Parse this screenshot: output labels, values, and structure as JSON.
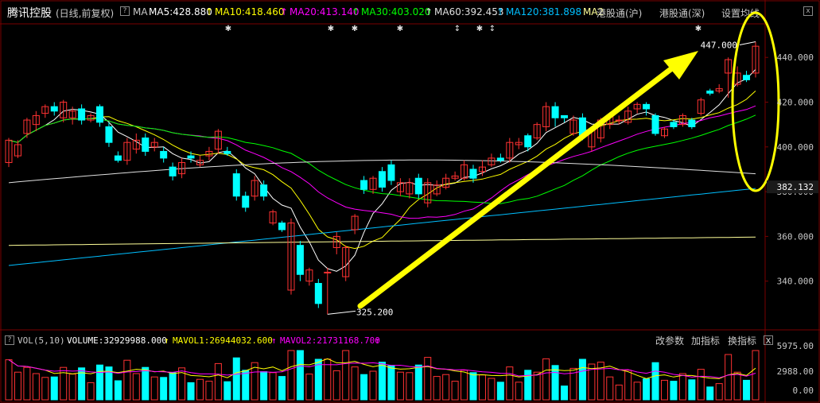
{
  "header": {
    "stock_name": "腾讯控股",
    "period": "(日线,前复权)",
    "ma_label": "MA",
    "ma5": "MA5:428.880",
    "ma10": "MA10:418.460",
    "ma20": "MA20:413.140",
    "ma30": "MA30:403.020",
    "ma60": "MA60:392.453",
    "ma120": "MA120:381.898",
    "ma_cut": "MA2",
    "hk_sh": "港股通(沪)",
    "hk_sz": "港股通(深)",
    "settings": "设置均线",
    "box_question": "?",
    "box_close": "x"
  },
  "price_axis": [
    "440.000",
    "420.000",
    "400.000",
    "380.000",
    "360.000",
    "340.000"
  ],
  "current_price": "382.132",
  "annotations": {
    "high": "447.000",
    "low": "325.200"
  },
  "volume": {
    "label": "VOL(5,10)",
    "volume_value": "VOLUME:32929988.000",
    "mavol1": "MAVOL1:26944032.600",
    "mavol2": "MAVOL2:21731168.700",
    "axis": [
      "5975.00",
      "2988.00",
      "0.00"
    ],
    "buttons": [
      "改参数",
      "加指标",
      "换指标"
    ],
    "close": "x"
  },
  "colors": {
    "up": "#ff3232",
    "down": "#00ffff",
    "ma5": "#ffffff",
    "ma10": "#ffff00",
    "ma20": "#ff00ff",
    "ma30": "#00ff00",
    "ma60": "#e0e0e0",
    "ma120": "#00bfff",
    "ma250": "#ffff99",
    "highlight": "#ffff00"
  },
  "chart_data": {
    "type": "candlestick",
    "candles": [
      {
        "o": 393,
        "c": 403,
        "h": 404,
        "l": 391
      },
      {
        "o": 396,
        "c": 401,
        "h": 403,
        "l": 395
      },
      {
        "o": 406,
        "c": 412,
        "h": 413,
        "l": 404
      },
      {
        "o": 410,
        "c": 414,
        "h": 416,
        "l": 407
      },
      {
        "o": 415,
        "c": 418,
        "h": 419,
        "l": 413
      },
      {
        "o": 418,
        "c": 416,
        "h": 420,
        "l": 414
      },
      {
        "o": 413,
        "c": 420,
        "h": 421,
        "l": 411
      },
      {
        "o": 413,
        "c": 416,
        "h": 418,
        "l": 410
      },
      {
        "o": 417,
        "c": 412,
        "h": 419,
        "l": 410
      },
      {
        "o": 412,
        "c": 414,
        "h": 415,
        "l": 411
      },
      {
        "o": 418,
        "c": 411,
        "h": 419,
        "l": 409
      },
      {
        "o": 409,
        "c": 402,
        "h": 411,
        "l": 400
      },
      {
        "o": 396,
        "c": 394,
        "h": 398,
        "l": 393
      },
      {
        "o": 394,
        "c": 402,
        "h": 404,
        "l": 392
      },
      {
        "o": 399,
        "c": 403,
        "h": 406,
        "l": 397
      },
      {
        "o": 404,
        "c": 398,
        "h": 406,
        "l": 396
      },
      {
        "o": 400,
        "c": 402,
        "h": 404,
        "l": 398
      },
      {
        "o": 398,
        "c": 395,
        "h": 400,
        "l": 393
      },
      {
        "o": 391,
        "c": 387,
        "h": 393,
        "l": 385
      },
      {
        "o": 388,
        "c": 393,
        "h": 395,
        "l": 386
      },
      {
        "o": 396,
        "c": 395,
        "h": 398,
        "l": 393
      },
      {
        "o": 392,
        "c": 394,
        "h": 396,
        "l": 391
      },
      {
        "o": 396,
        "c": 398,
        "h": 400,
        "l": 394
      },
      {
        "o": 399,
        "c": 407,
        "h": 408,
        "l": 397
      },
      {
        "o": 398,
        "c": 397,
        "h": 400,
        "l": 396
      },
      {
        "o": 388,
        "c": 378,
        "h": 390,
        "l": 376
      },
      {
        "o": 378,
        "c": 373,
        "h": 380,
        "l": 371
      },
      {
        "o": 378,
        "c": 385,
        "h": 387,
        "l": 376
      },
      {
        "o": 383,
        "c": 378,
        "h": 385,
        "l": 376
      },
      {
        "o": 366,
        "c": 371,
        "h": 372,
        "l": 365
      },
      {
        "o": 366,
        "c": 363,
        "h": 367,
        "l": 362
      },
      {
        "o": 336,
        "c": 366,
        "h": 368,
        "l": 334
      },
      {
        "o": 356,
        "c": 343,
        "h": 358,
        "l": 340
      },
      {
        "o": 340,
        "c": 345,
        "h": 346,
        "l": 338
      },
      {
        "o": 339,
        "c": 330,
        "h": 341,
        "l": 328
      },
      {
        "o": 344,
        "c": 344,
        "h": 346,
        "l": 325.2
      },
      {
        "o": 355,
        "c": 360,
        "h": 362,
        "l": 352
      },
      {
        "o": 342,
        "c": 355,
        "h": 356,
        "l": 340
      },
      {
        "o": 363,
        "c": 369,
        "h": 370,
        "l": 361
      },
      {
        "o": 385,
        "c": 381,
        "h": 387,
        "l": 379
      },
      {
        "o": 381,
        "c": 386,
        "h": 387,
        "l": 379
      },
      {
        "o": 389,
        "c": 382,
        "h": 391,
        "l": 380
      },
      {
        "o": 392,
        "c": 385,
        "h": 394,
        "l": 383
      },
      {
        "o": 380,
        "c": 384,
        "h": 386,
        "l": 378
      },
      {
        "o": 379,
        "c": 384,
        "h": 386,
        "l": 377
      },
      {
        "o": 386,
        "c": 379,
        "h": 388,
        "l": 377
      },
      {
        "o": 375,
        "c": 384,
        "h": 386,
        "l": 373
      },
      {
        "o": 379,
        "c": 383,
        "h": 385,
        "l": 378
      },
      {
        "o": 382,
        "c": 386,
        "h": 388,
        "l": 381
      },
      {
        "o": 386,
        "c": 387,
        "h": 389,
        "l": 385
      },
      {
        "o": 386,
        "c": 392,
        "h": 394,
        "l": 385
      },
      {
        "o": 390,
        "c": 386,
        "h": 392,
        "l": 384
      },
      {
        "o": 389,
        "c": 391,
        "h": 394,
        "l": 387
      },
      {
        "o": 392,
        "c": 395,
        "h": 397,
        "l": 391
      },
      {
        "o": 395,
        "c": 394,
        "h": 397,
        "l": 393
      },
      {
        "o": 395,
        "c": 402,
        "h": 404,
        "l": 393
      },
      {
        "o": 401,
        "c": 402,
        "h": 404,
        "l": 399
      },
      {
        "o": 405,
        "c": 400,
        "h": 406,
        "l": 398
      },
      {
        "o": 404,
        "c": 410,
        "h": 411,
        "l": 403
      },
      {
        "o": 409,
        "c": 418,
        "h": 420,
        "l": 407
      },
      {
        "o": 418,
        "c": 413,
        "h": 420,
        "l": 409
      },
      {
        "o": 414,
        "c": 413,
        "h": 414,
        "l": 411
      },
      {
        "o": 406,
        "c": 412,
        "h": 414,
        "l": 405
      },
      {
        "o": 413,
        "c": 405,
        "h": 415,
        "l": 403
      },
      {
        "o": 400,
        "c": 408,
        "h": 409,
        "l": 398
      },
      {
        "o": 404,
        "c": 412,
        "h": 413,
        "l": 402
      },
      {
        "o": 410,
        "c": 414,
        "h": 415,
        "l": 408
      },
      {
        "o": 412,
        "c": 412,
        "h": 414,
        "l": 410
      },
      {
        "o": 411,
        "c": 416,
        "h": 418,
        "l": 410
      },
      {
        "o": 417,
        "c": 419,
        "h": 420,
        "l": 415
      },
      {
        "o": 419,
        "c": 417,
        "h": 420,
        "l": 414
      },
      {
        "o": 414,
        "c": 406,
        "h": 415,
        "l": 405
      },
      {
        "o": 405,
        "c": 408,
        "h": 409,
        "l": 404
      },
      {
        "o": 411,
        "c": 409,
        "h": 412,
        "l": 408
      },
      {
        "o": 410,
        "c": 414,
        "h": 415,
        "l": 409
      },
      {
        "o": 412,
        "c": 409,
        "h": 413,
        "l": 408
      },
      {
        "o": 415,
        "c": 421,
        "h": 422,
        "l": 414
      },
      {
        "o": 425,
        "c": 424,
        "h": 426,
        "l": 423
      },
      {
        "o": 425,
        "c": 426,
        "h": 428,
        "l": 424
      },
      {
        "o": 433,
        "c": 439,
        "h": 440,
        "l": 422
      },
      {
        "o": 428,
        "c": 433,
        "h": 436,
        "l": 427
      },
      {
        "o": 432,
        "c": 430,
        "h": 434,
        "l": 429
      },
      {
        "o": 433,
        "c": 445,
        "h": 447,
        "l": 431
      }
    ],
    "ma_series": [
      "MA5",
      "MA10",
      "MA20",
      "MA30",
      "MA60",
      "MA120"
    ],
    "ylim": [
      320,
      455
    ]
  }
}
